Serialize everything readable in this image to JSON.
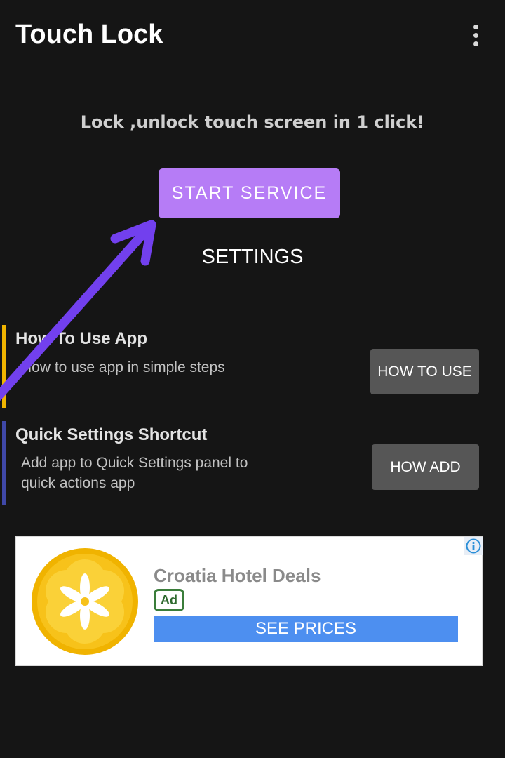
{
  "app_bar": {
    "title": "Touch Lock",
    "overflow_icon": "more-vert-icon"
  },
  "main": {
    "tagline": "Lock ,unlock touch screen in 1 click!",
    "start_button": "START SERVICE",
    "settings_link": "SETTINGS"
  },
  "cards": [
    {
      "title": "How To Use App",
      "description": "How to use app in simple steps",
      "button": "HOW TO USE",
      "accent_color": "#f0b400"
    },
    {
      "title": "Quick Settings Shortcut",
      "description_line1": "Add app to Quick Settings panel to",
      "description_line2": "quick actions app",
      "button": "HOW ADD",
      "accent_color": "#3f48a8"
    }
  ],
  "ad": {
    "title": "Croatia Hotel Deals",
    "badge": "Ad",
    "cta": "SEE PRICES",
    "info_icon": "info-icon",
    "logo_icon": "flower-logo-icon"
  },
  "annotation": {
    "arrow_color": "#7240ee",
    "arrow_icon": "arrow-annotation-icon"
  },
  "colors": {
    "background": "#151515",
    "primary": "#b67cf6",
    "ad_cta": "#4d8ff0"
  }
}
